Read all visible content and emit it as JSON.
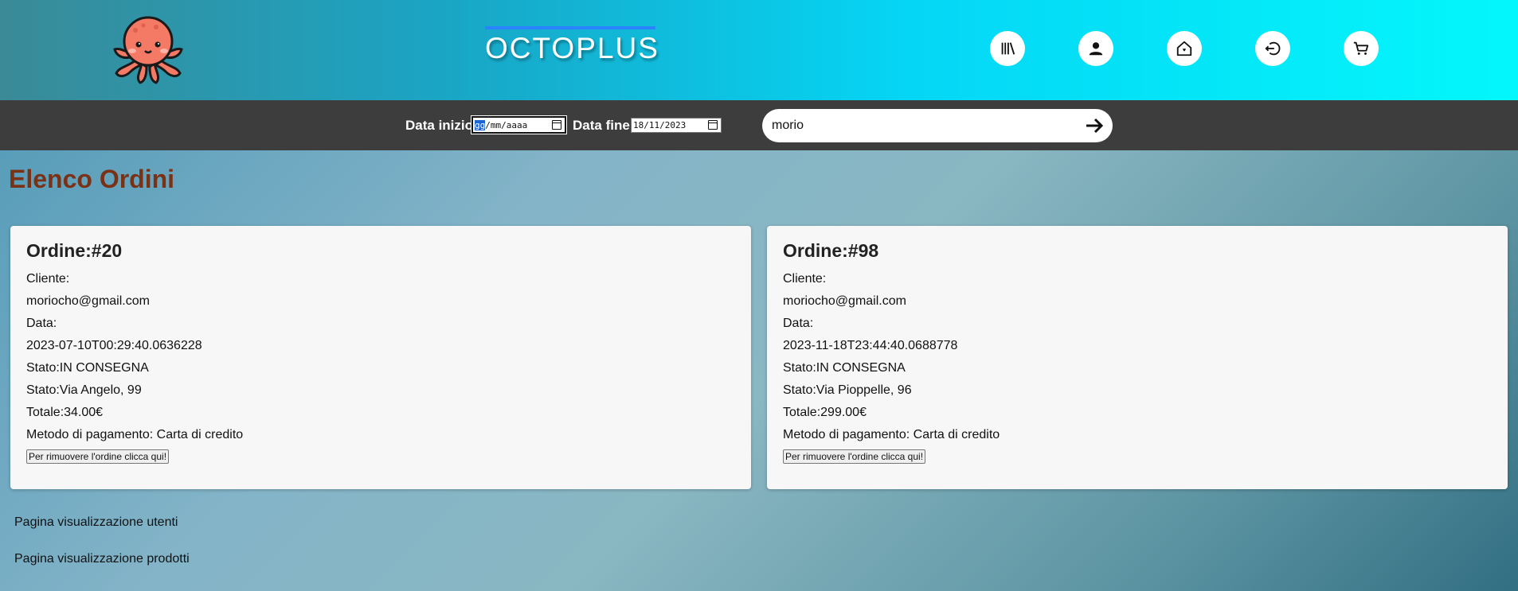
{
  "header": {
    "brand": "OCTOPLUS",
    "nav_icons": [
      "library-icon",
      "user-icon",
      "home-icon",
      "logout-icon",
      "cart-icon"
    ]
  },
  "filters": {
    "start_label": "Data inizio:",
    "start_value_sel": "gg",
    "start_value_rest": "/mm/aaaa",
    "end_label": "Data fine:",
    "end_value": "18/11/2023",
    "search_value": "morio"
  },
  "main": {
    "title": "Elenco Ordini",
    "orders": [
      {
        "title": "Ordine:#20",
        "cliente_label": "Cliente:",
        "cliente": "moriocho@gmail.com",
        "data_label": "Data:",
        "data": "2023-07-10T00:29:40.0636228",
        "stato": "Stato:IN CONSEGNA",
        "indirizzo": "Stato:Via Angelo, 99",
        "totale": "Totale:34.00€",
        "pagamento": "Metodo di pagamento: Carta di credito",
        "remove_label": "Per rimuovere l'ordine clicca qui!"
      },
      {
        "title": "Ordine:#98",
        "cliente_label": "Cliente:",
        "cliente": "moriocho@gmail.com",
        "data_label": "Data:",
        "data": "2023-11-18T23:44:40.0688778",
        "stato": "Stato:IN CONSEGNA",
        "indirizzo": "Stato:Via Pioppelle, 96",
        "totale": "Totale:299.00€",
        "pagamento": "Metodo di pagamento: Carta di credito",
        "remove_label": "Per rimuovere l'ordine clicca qui!"
      }
    ],
    "links": {
      "users": "Pagina visualizzazione utenti",
      "products": "Pagina visualizzazione prodotti"
    }
  },
  "colors": {
    "title": "#7a3217",
    "filterbar": "#3d3d3d",
    "brand_underline": "#2a83ff"
  }
}
